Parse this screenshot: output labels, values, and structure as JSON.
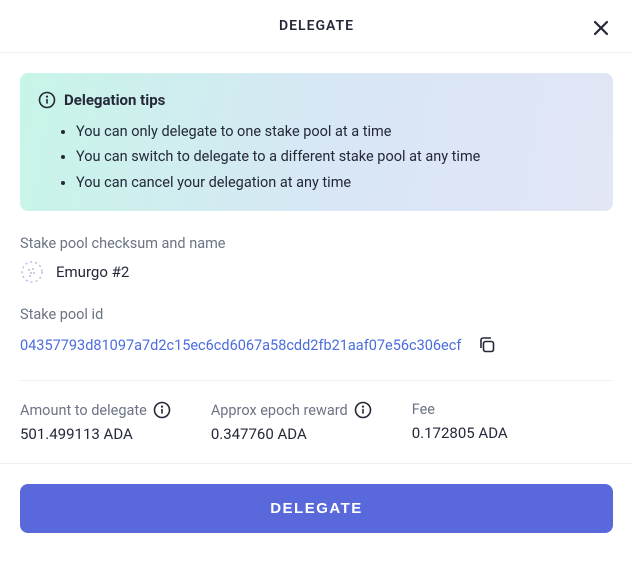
{
  "header": {
    "title": "DELEGATE"
  },
  "tips": {
    "title": "Delegation tips",
    "items": [
      "You can only delegate to one stake pool at a time",
      "You can switch to delegate to a different stake pool at any time",
      "You can cancel your delegation at any time"
    ]
  },
  "pool": {
    "section_label": "Stake pool checksum and name",
    "name": "Emurgo #2",
    "id_label": "Stake pool id",
    "id": "04357793d81097a7d2c15ec6cd6067a58cdd2fb21aaf07e56c306ecf"
  },
  "stats": {
    "amount_label": "Amount to delegate",
    "amount_value": "501.499113 ADA",
    "approx_label": "Approx epoch reward",
    "approx_value": "0.347760 ADA",
    "fee_label": "Fee",
    "fee_value": "0.172805 ADA"
  },
  "actions": {
    "delegate": "DELEGATE"
  }
}
